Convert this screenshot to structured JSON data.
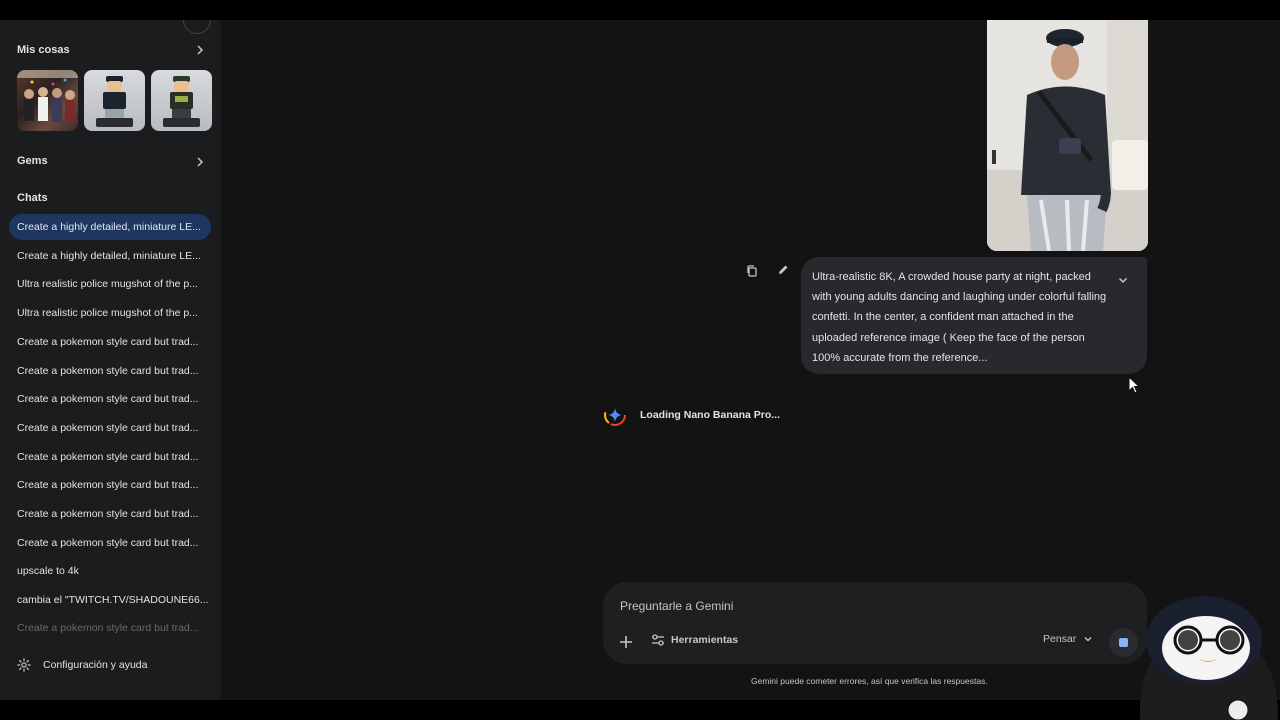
{
  "sidebar": {
    "my_stuff_label": "Mis cosas",
    "gems_label": "Gems",
    "chats_label": "Chats",
    "chats": [
      {
        "label": "Create a highly detailed, miniature LE...",
        "active": true
      },
      {
        "label": "Create a highly detailed, miniature LE..."
      },
      {
        "label": "Ultra realistic police mugshot of the p..."
      },
      {
        "label": "Ultra realistic police mugshot of the p..."
      },
      {
        "label": "Create a pokemon style card but trad..."
      },
      {
        "label": "Create a pokemon style card but trad..."
      },
      {
        "label": "Create a pokemon style card but trad..."
      },
      {
        "label": "Create a pokemon style card but trad..."
      },
      {
        "label": "Create a pokemon style card but trad..."
      },
      {
        "label": "Create a pokemon style card but trad..."
      },
      {
        "label": "Create a pokemon style card but trad..."
      },
      {
        "label": "Create a pokemon style card but trad..."
      },
      {
        "label": "upscale to 4k"
      },
      {
        "label": "cambia el \"TWITCH.TV/SHADOUNE66..."
      },
      {
        "label": "Create a pokemon style card but trad..."
      }
    ],
    "settings_label": "Configuración y ayuda"
  },
  "conversation": {
    "user_message": "Ultra-realistic 8K, A crowded house party at night, packed with young adults dancing and laughing under colorful falling confetti. In the center, a confident man attached in the uploaded reference image ( Keep the face of the person 100% accurate from the reference...",
    "loading_text": "Loading Nano Banana Pro..."
  },
  "input": {
    "placeholder": "Preguntarle a Gemini",
    "tools_label": "Herramientas",
    "mode_label": "Pensar"
  },
  "footer": {
    "disclaimer": "Gemini puede cometer errores, así que verifica las respuestas."
  },
  "colors": {
    "sidebar_bg": "#1b1c1e",
    "main_bg": "#131314",
    "active_chat": "#1f3760",
    "accent": "#8ab4f8"
  }
}
